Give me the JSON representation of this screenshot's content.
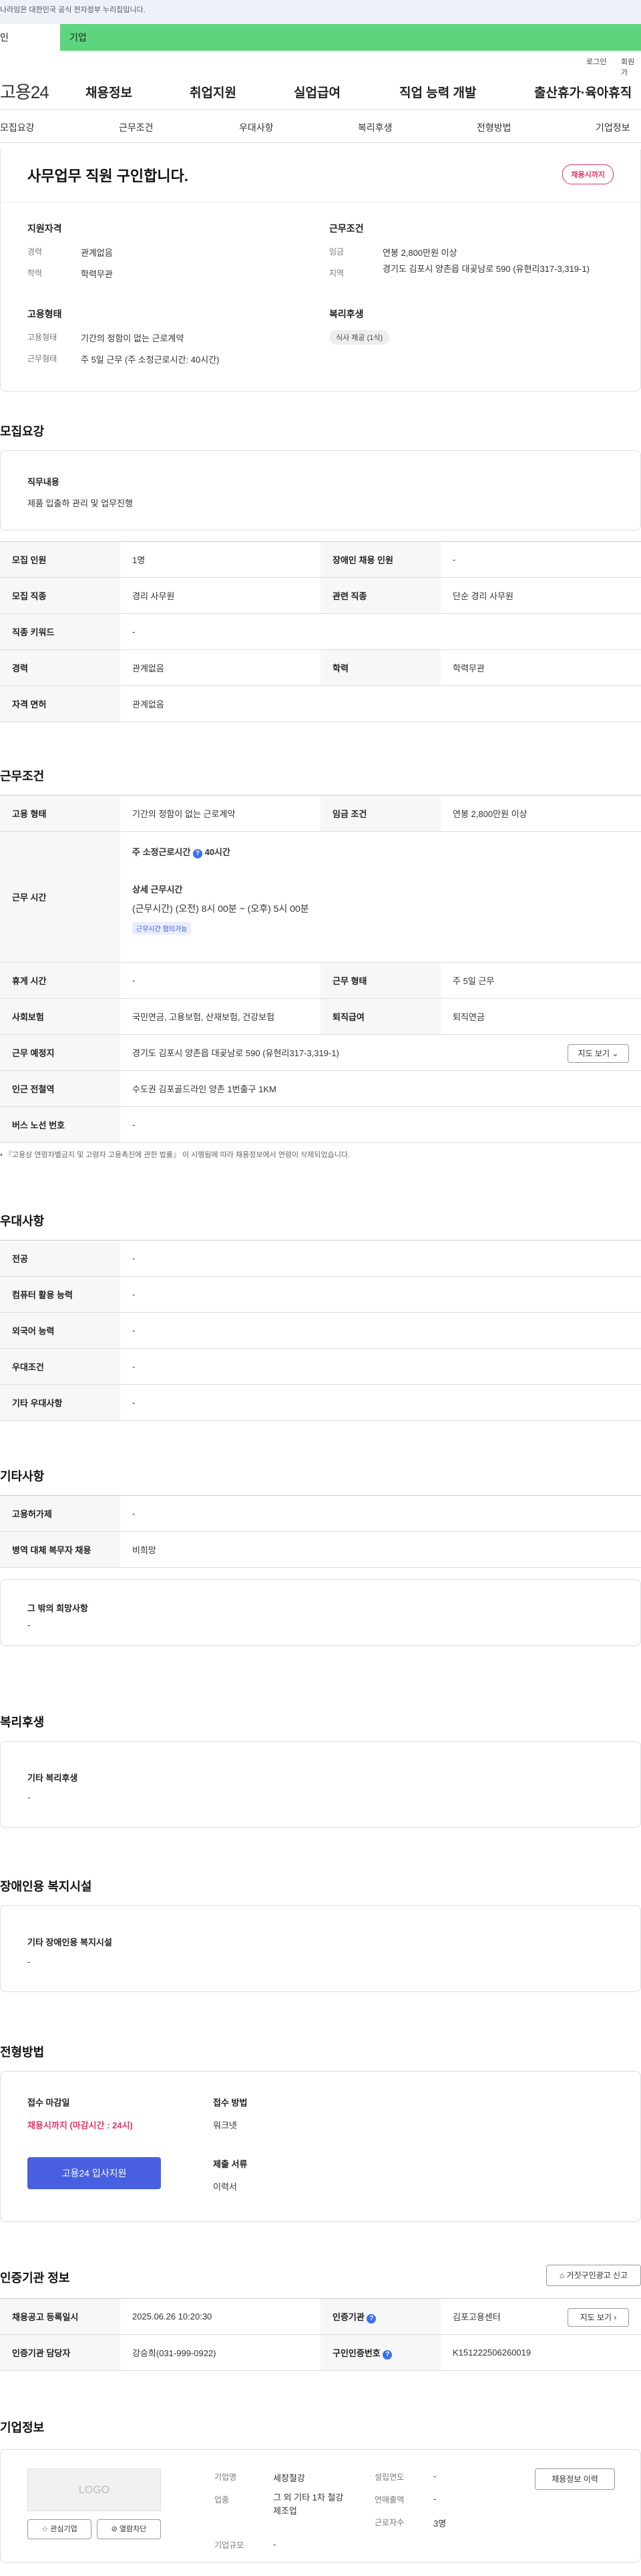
{
  "banner": {
    "text": "나라임은 대한민국 공식 전자정부 누리집입니다."
  },
  "user_tabs": {
    "personal": "인",
    "company": "기업"
  },
  "topbar": {
    "login": "로그인",
    "join": "회원가"
  },
  "gnb": {
    "logo": "고용24",
    "menu": [
      "채용정보",
      "취업지원",
      "실업급여",
      "직업 능력 개발",
      "출산휴가·육아휴직"
    ]
  },
  "anchor_tabs": [
    "모집요강",
    "근무조건",
    "우대사항",
    "복리후생",
    "전형방법",
    "기업정보"
  ],
  "summary": {
    "title": "사무업무 직원 구인합니다.",
    "deadline_badge": "채용시까지",
    "qualification": {
      "heading": "지원자격",
      "career_label": "경력",
      "career_value": "관계없음",
      "edu_label": "학력",
      "edu_value": "학력무관"
    },
    "conditions": {
      "heading": "근무조건",
      "wage_label": "임금",
      "wage_value": "연봉 2,800만원 이상",
      "region_label": "지역",
      "region_value": "경기도 김포시 양촌읍 대곶남로 590 (유현리317-3,319-1)"
    },
    "employment": {
      "heading": "고용형태",
      "type_label": "고용형태",
      "type_value": "기간의 정함이 없는 근로계약",
      "hours_label": "근무형태",
      "hours_value": "주 5일 근무 (주 소정근로시간: 40시간)"
    },
    "welfare": {
      "heading": "복리후생",
      "tag": "식사 제공 (1식)"
    }
  },
  "recruit": {
    "title": "모집요강",
    "duty_label": "직무내용",
    "duty_value": "제품 입출하 관리 및 업무진행",
    "rows": {
      "count_label": "모집 인원",
      "count_value": "1명",
      "disabled_label": "장애인 채용 인원",
      "disabled_value": "-",
      "job_label": "모집 직종",
      "job_value": "경리 사무원",
      "related_label": "관련 직종",
      "related_value": "단순 경리 사무원",
      "keyword_label": "직종 키워드",
      "keyword_value": "-",
      "career_label": "경력",
      "career_value": "관계없음",
      "edu_label": "학력",
      "edu_value": "학력무관",
      "license_label": "자격 면허",
      "license_value": "관계없음"
    }
  },
  "work": {
    "title": "근무조건",
    "type_label": "고용 형태",
    "type_value": "기간의 정함이 없는 근로계약",
    "wage_label": "임금 조건",
    "wage_value": "연봉 2,800만원 이상",
    "hours_label": "근무 시간",
    "weekly_label": "주 소정근로시간",
    "weekly_value": "40시간",
    "detail_label": "상세 근무시간",
    "detail_value": "(근무시간) (오전) 8시 00분 ~ (오후) 5시 00분",
    "detail_tag": "근무시간 협의가능",
    "holiday_label": "휴게 시간",
    "holiday_value": "-",
    "worktype_label": "근무 형태",
    "worktype_value": "주 5일 근무",
    "insurance_label": "사회보험",
    "insurance_value": "국민연금, 고용보험, 산재보험, 건강보험",
    "severance_label": "퇴직급여",
    "severance_value": "퇴직연금",
    "place_label": "근무 예정지",
    "place_value": "경기도 김포시 양촌읍 대곶남로 590 (유현리317-3,319-1)",
    "map_button": "지도 보기",
    "subway_label": "인근 전철역",
    "subway_value": "수도권 김포골드라인 양촌 1번출구 1KM",
    "bus_label": "버스 노선 번호",
    "bus_value": "-",
    "notice": "『고용상 연령차별금지 및 고령자 고용촉진에 관한 법률』 이 시행됨에 따라 채용정보에서 연령이 삭제되었습니다."
  },
  "preference": {
    "title": "우대사항",
    "major_label": "전공",
    "major_value": "-",
    "computer_label": "컴퓨터 활용 능력",
    "computer_value": "-",
    "language_label": "외국어 능력",
    "language_value": "-",
    "cond_label": "우대조건",
    "cond_value": "-",
    "etc_label": "기타 우대사항",
    "etc_value": "-"
  },
  "other": {
    "title": "기타사항",
    "equip_label": "고용허가제",
    "equip_value": "-",
    "military_label": "병역 대체 복무자 채용",
    "military_value": "비희망",
    "wish_label": "그 밖의 희망사항",
    "wish_value": "-"
  },
  "welfare": {
    "title": "복리후생",
    "label": "기타 복리후생",
    "value": "-"
  },
  "disabled_facility": {
    "title": "장애인용 복지시설",
    "label": "기타 장애인용 복지시설",
    "value": "-"
  },
  "selection": {
    "title": "전형방법",
    "deadline_label": "접수 마감일",
    "deadline_value": "채용시까지 (마감시간 : 24시)",
    "apply_button": "고용24 입사지원",
    "method_label": "접수 방법",
    "method_value": "워크넷",
    "docs_label": "제출 서류",
    "docs_value": "이력서"
  },
  "certifier": {
    "title": "인증기관 정보",
    "report_button": "거짓구인광고 신고",
    "reg_label": "채용공고 등록일시",
    "reg_value": "2025.06.26 10:20:30",
    "org_label": "인증기관",
    "org_value": "김포고용센터",
    "map_button": "지도 보기",
    "manager_label": "인증기관 담당자",
    "manager_value": "강승희(031-999-0922)",
    "id_label": "구인인증번호",
    "id_value": "K151222506260019"
  },
  "company": {
    "title": "기업정보",
    "logo_text": "LOGO",
    "fav_button": "관심기업",
    "block_button": "열람차단",
    "name_label": "기업명",
    "name_value": "세창철강",
    "industry_label": "업종",
    "industry_value": "그 외 기타 1차 철강 제조업",
    "size_label": "기업규모",
    "size_value": "-",
    "year_label": "설립연도",
    "year_value": "-",
    "revenue_label": "연매출액",
    "revenue_value": "-",
    "staff_label": "근로자수",
    "staff_value": "3명",
    "history_button": "채용정보 이력"
  }
}
